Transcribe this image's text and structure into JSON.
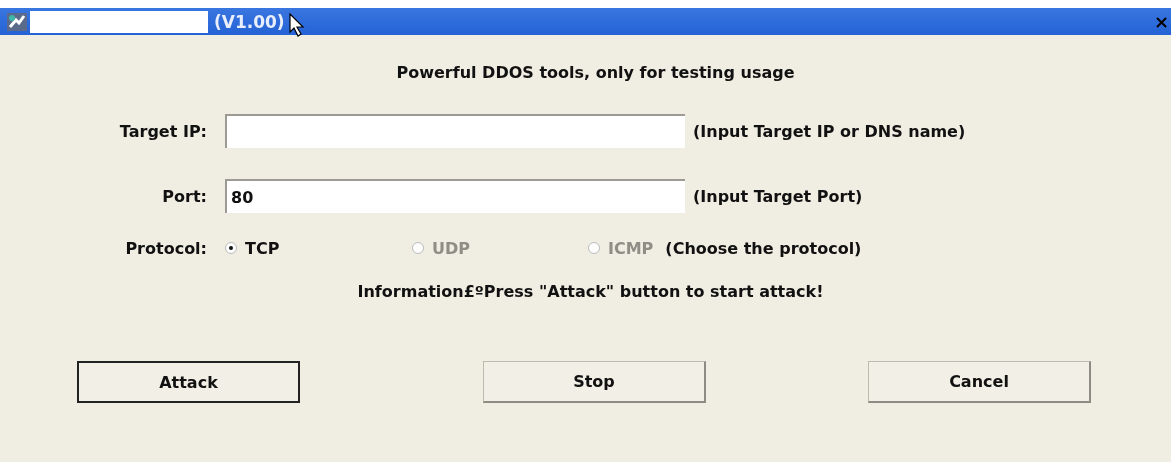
{
  "window": {
    "title": "(V1.00)",
    "close": "×"
  },
  "heading": "Powerful DDOS tools, only for testing usage",
  "fields": [
    {
      "label": "Target IP:",
      "hint": "(Input Target IP or DNS name)"
    },
    {
      "label": "Port:",
      "value": "80",
      "hint": "(Input Target Port)"
    }
  ],
  "protocol": {
    "label": "Protocol:",
    "hint": "(Choose the protocol)",
    "options": [
      {
        "label": "TCP",
        "selected": true,
        "disabled": false
      },
      {
        "label": "UDP",
        "selected": false,
        "disabled": true
      },
      {
        "label": "ICMP",
        "selected": false,
        "disabled": true
      }
    ]
  },
  "information": "Information£ºPress \"Attack\" button to start attack!",
  "buttons": [
    {
      "label": "Attack",
      "default": true
    },
    {
      "label": "Stop",
      "default": false
    },
    {
      "label": "Cancel",
      "default": false
    }
  ]
}
